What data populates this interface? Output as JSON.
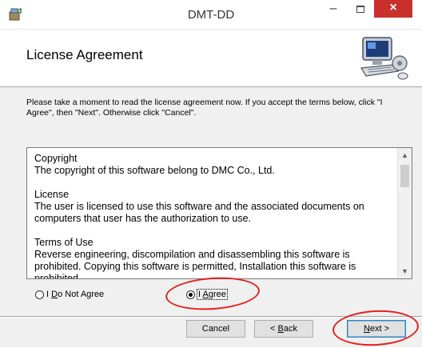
{
  "window": {
    "title": "DMT-DD",
    "minimize_glyph": "–",
    "close_glyph": "×"
  },
  "header": {
    "title": "License Agreement",
    "art_icon": "computer-setup-icon"
  },
  "instructions": "Please take a moment to read the license agreement now. If you accept the terms below, click \"I Agree\", then \"Next\". Otherwise click \"Cancel\".",
  "license": {
    "paragraphs": [
      "Copyright\nThe copyright of this software belong to DMC Co., Ltd.",
      "License\nThe user is licensed to use this software and the associated documents on computers that user has the authorization to use.",
      "Terms of Use\nReverse engineering, discompilation and disassembling this software is prohibited. Copying this software is permitted, Installation this software is prohibited"
    ]
  },
  "radio": {
    "do_not_agree_prefix": "I ",
    "do_not_agree_key": "D",
    "do_not_agree_rest": "o Not Agree",
    "agree_prefix": "I ",
    "agree_key": "A",
    "agree_rest": "gree",
    "selected": "agree"
  },
  "buttons": {
    "cancel": "Cancel",
    "back_prefix": "< ",
    "back_key": "B",
    "back_rest": "ack",
    "next_key": "N",
    "next_rest": "ext >"
  },
  "colors": {
    "annotation": "#e52020",
    "close_button": "#c9302c"
  }
}
